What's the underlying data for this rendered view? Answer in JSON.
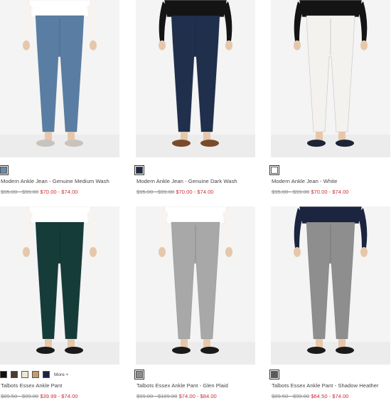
{
  "products": [
    {
      "name": "Modern Ankle Jean - Genuine Medium Wash",
      "price_original": "$95.00 - $99.00",
      "price_sale": "$70.00 - $74.00",
      "swatches": [
        "#6b8aa8"
      ],
      "top_color": "#ffffff",
      "pant_color": "#5a7ea3",
      "shoe_color": "#c9c2bd"
    },
    {
      "name": "Modern Ankle Jean - Genuine Dark Wash",
      "price_original": "$95.00 - $99.00",
      "price_sale": "$70.00 - $74.00",
      "swatches": [
        "#1d2a44"
      ],
      "top_color": "#141414",
      "pant_color": "#1f2f4c",
      "shoe_color": "#7a4b2a"
    },
    {
      "name": "Modern Ankle Jean - White",
      "price_original": "$95.00 - $99.00",
      "price_sale": "$70.00 - $74.00",
      "swatches": [
        "#ffffff"
      ],
      "top_color": "#141414",
      "pant_color": "#f4f2ee",
      "shoe_color": "#1c2436"
    },
    {
      "name": "Talbots Essex Ankle Pant",
      "price_original": "$89.50 - $99.00",
      "price_sale": "$39.99 - $74.00",
      "swatches": [
        "#111111",
        "#4a3b2d",
        "#efe6d6",
        "#c79a6a",
        "#1b2540"
      ],
      "more_label": "More +",
      "top_color": "#ffffff",
      "pant_color": "#163c3a",
      "shoe_color": "#1a1a1a"
    },
    {
      "name": "Talbots Essex Ankle Pant - Glen Plaid",
      "price_original": "$99.00 - $109.00",
      "price_sale": "$74.00 - $84.00",
      "swatches": [
        "#8c8c8c"
      ],
      "top_color": "#ffffff",
      "pant_color": "#a8a8a8",
      "shoe_color": "#1a1a1a"
    },
    {
      "name": "Talbots Essex Ankle Pant - Shadow Heather",
      "price_original": "$89.50 - $99.00",
      "price_sale": "$64.50 - $74.00",
      "swatches": [
        "#5a5a5a"
      ],
      "top_color": "#1b2540",
      "pant_color": "#8e8e8e",
      "shoe_color": "#1a1a1a"
    }
  ]
}
